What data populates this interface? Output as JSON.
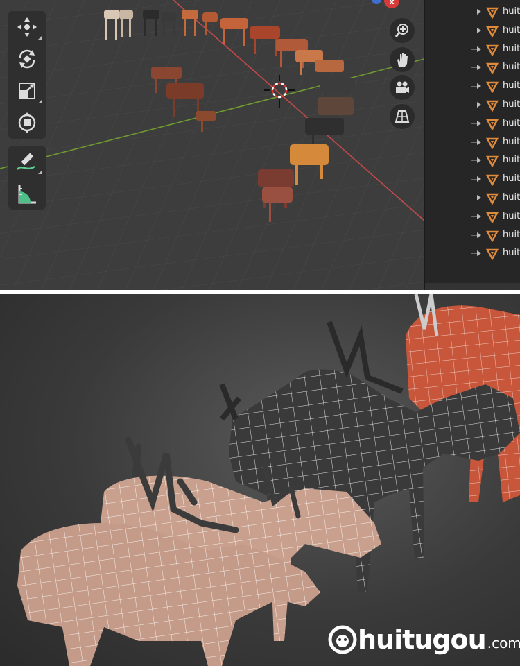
{
  "toolbar": {
    "tools": [
      {
        "name": "move-tool",
        "icon": "move-arrows-icon"
      },
      {
        "name": "rotate-tool",
        "icon": "rotate-icon"
      },
      {
        "name": "scale-tool",
        "icon": "scale-icon"
      },
      {
        "name": "transform-tool",
        "icon": "transform-icon"
      },
      {
        "name": "annotate-tool",
        "icon": "pencil-annotate-icon"
      },
      {
        "name": "measure-tool",
        "icon": "ruler-measure-icon"
      }
    ]
  },
  "navigation": {
    "buttons": [
      "zoom-icon",
      "hand-pan-icon",
      "camera-icon",
      "grid-ortho-icon"
    ]
  },
  "outliner": {
    "item_label": "huit",
    "rows": [
      "huit",
      "huit",
      "huit",
      "huit",
      "huit",
      "huit",
      "huit",
      "huit",
      "huit",
      "huit",
      "huit",
      "huit",
      "huit",
      "huit"
    ]
  },
  "gizmo": {
    "close_label": "x"
  },
  "watermark": {
    "brand": "huitugou",
    "suffix": ".com"
  },
  "colors": {
    "viewport_bg": "#3d3d3d",
    "x_axis": "#c44a4a",
    "y_axis": "#6f9a2f",
    "outliner_icon": "#e08a3c"
  }
}
